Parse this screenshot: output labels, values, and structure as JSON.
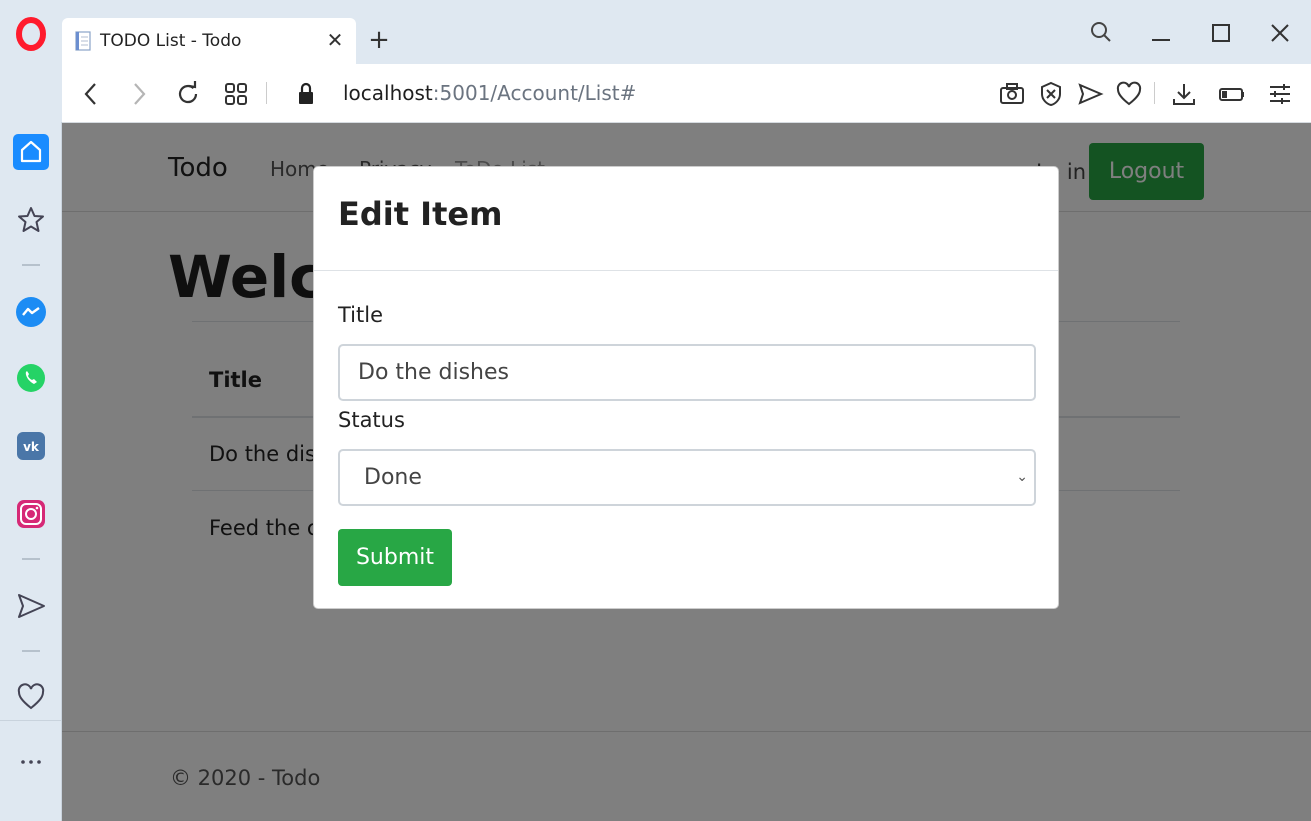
{
  "browser": {
    "tab": {
      "title": "TODO List - Todo"
    },
    "address_bar": {
      "host": "localhost",
      "path": ":5001/Account/List#"
    }
  },
  "page": {
    "navbar": {
      "brand": "Todo",
      "links": [
        "Home",
        "Privacy",
        "ToDo List"
      ],
      "login_text": "Lo in",
      "logout_label": "Logout"
    },
    "heading": "Welco",
    "table": {
      "header": "Title",
      "rows": [
        "Do the dis",
        "Feed the c"
      ]
    },
    "footer": "© 2020 - Todo"
  },
  "modal": {
    "title": "Edit Item",
    "title_label": "Title",
    "title_value": "Do the dishes",
    "status_label": "Status",
    "status_value": "Done",
    "submit_label": "Submit"
  },
  "colors": {
    "accent_green": "#28a745",
    "sidebar_bg": "#dfe8f1",
    "opera_red": "#ff1b2d"
  },
  "icons": [
    "opera-logo-icon",
    "home-icon",
    "star-icon",
    "messenger-icon",
    "whatsapp-icon",
    "vk-icon",
    "instagram-icon",
    "send-icon",
    "heart-icon",
    "more-icon"
  ]
}
